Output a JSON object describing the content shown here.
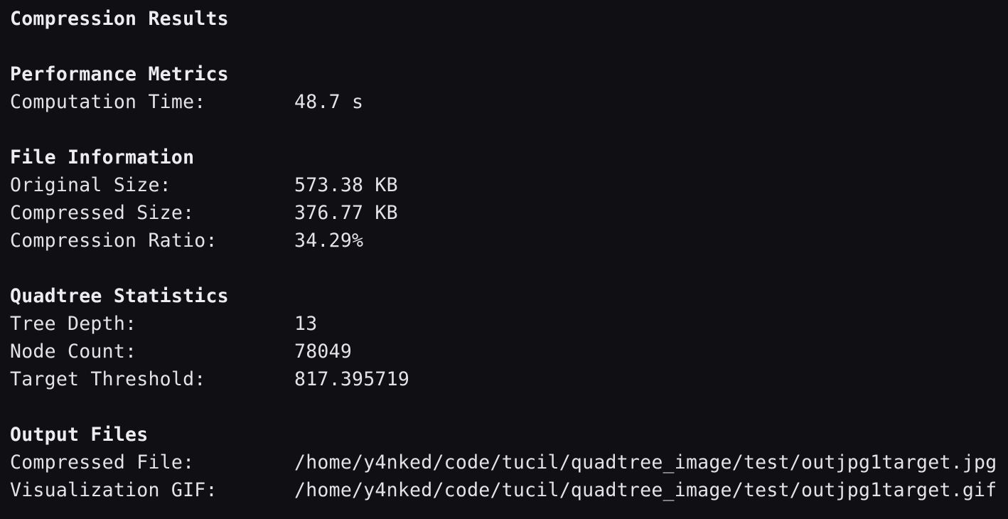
{
  "title": "Compression Results",
  "sections": [
    {
      "title": "Performance Metrics",
      "rows": [
        {
          "label": "Computation Time:",
          "value": "48.7 s"
        }
      ]
    },
    {
      "title": "File Information",
      "rows": [
        {
          "label": "Original Size:",
          "value": "573.38 KB"
        },
        {
          "label": "Compressed Size:",
          "value": "376.77 KB"
        },
        {
          "label": "Compression Ratio:",
          "value": "34.29%"
        }
      ]
    },
    {
      "title": "Quadtree Statistics",
      "rows": [
        {
          "label": "Tree Depth:",
          "value": "13"
        },
        {
          "label": "Node Count:",
          "value": "78049"
        },
        {
          "label": "Target Threshold:",
          "value": "817.395719"
        }
      ]
    },
    {
      "title": "Output Files",
      "rows": [
        {
          "label": "Compressed File:",
          "value": "/home/y4nked/code/tucil/quadtree_image/test/outjpg1target.jpg"
        },
        {
          "label": "Visualization GIF:",
          "value": "/home/y4nked/code/tucil/quadtree_image/test/outjpg1target.gif"
        }
      ]
    }
  ],
  "colors": {
    "background": "#101014",
    "text": "#e3e3e8"
  }
}
